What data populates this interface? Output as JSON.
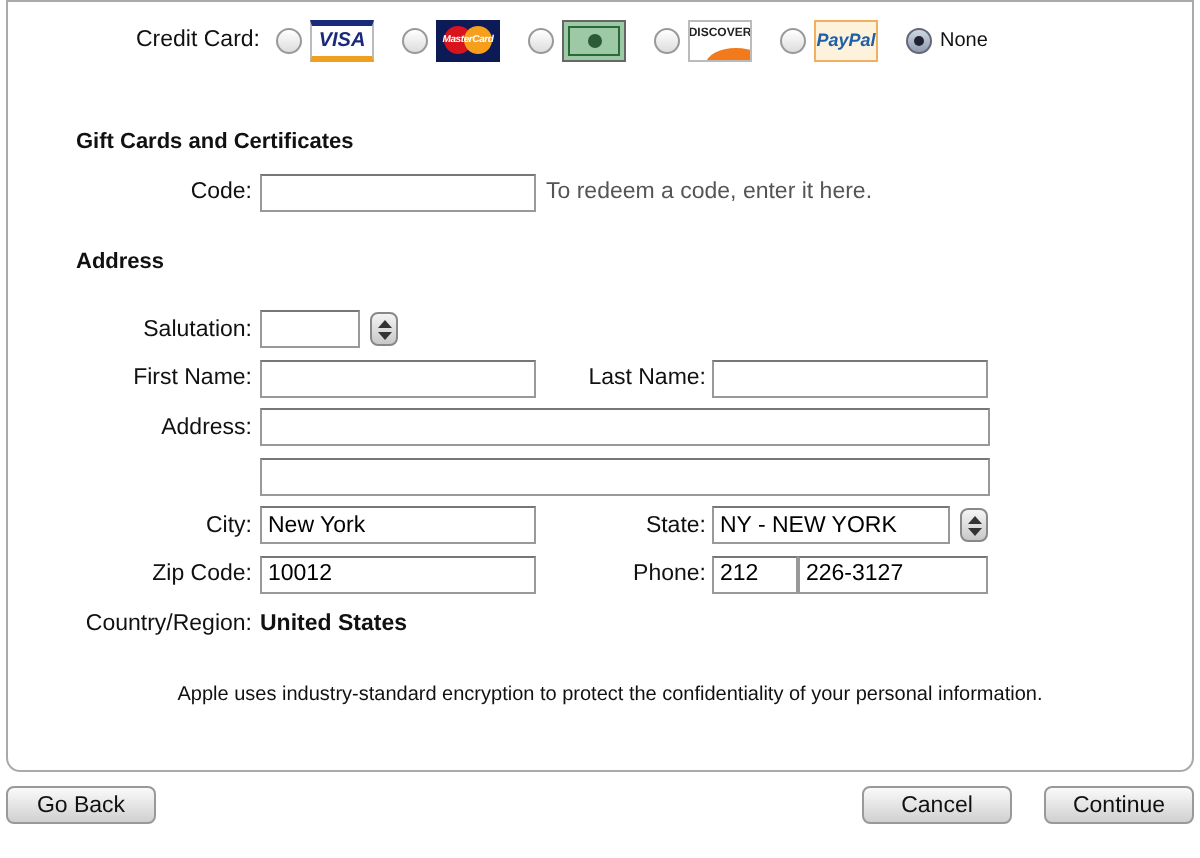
{
  "credit_card": {
    "label": "Credit Card:",
    "options": [
      {
        "kind": "visa",
        "logo_text": "VISA",
        "selected": false
      },
      {
        "kind": "mastercard",
        "logo_text": "MasterCard",
        "selected": false
      },
      {
        "kind": "amex",
        "selected": false
      },
      {
        "kind": "discover",
        "logo_text": "DISCOVER",
        "selected": false
      },
      {
        "kind": "paypal",
        "logo_text": "PayPal",
        "selected": false
      },
      {
        "kind": "none",
        "label": "None",
        "selected": true
      }
    ]
  },
  "gift_cards": {
    "heading": "Gift Cards and Certificates",
    "code_label": "Code:",
    "hint": "To redeem a code, enter it here."
  },
  "address": {
    "heading": "Address",
    "rows": [
      {
        "fields": [
          {
            "kind": "short-select",
            "label": "Salutation:"
          }
        ]
      },
      {
        "fields": [
          {
            "kind": "text",
            "label": "First Name:"
          },
          {
            "kind": "text",
            "label": "Last Name:"
          }
        ]
      },
      {
        "fields": [
          {
            "kind": "wide-text",
            "label": "Address:"
          }
        ]
      },
      {
        "fields": [
          {
            "kind": "wide-text"
          }
        ]
      },
      {
        "fields": [
          {
            "kind": "text",
            "label": "City:",
            "value": "New York"
          },
          {
            "kind": "select",
            "label": "State:",
            "value": "NY - NEW YORK"
          }
        ]
      },
      {
        "fields": [
          {
            "kind": "text",
            "label": "Zip Code:",
            "value": "10012"
          },
          {
            "kind": "phone",
            "label": "Phone:",
            "area_code": "212",
            "value": "226-3127"
          }
        ]
      },
      {
        "fields": [
          {
            "kind": "static",
            "label": "Country/Region:",
            "value": "United States"
          }
        ]
      }
    ]
  },
  "privacy_note": "Apple uses industry-standard encryption to protect the confidentiality of your personal information.",
  "buttons": {
    "left": [
      "Go Back"
    ],
    "right": [
      "Cancel",
      "Continue"
    ]
  }
}
